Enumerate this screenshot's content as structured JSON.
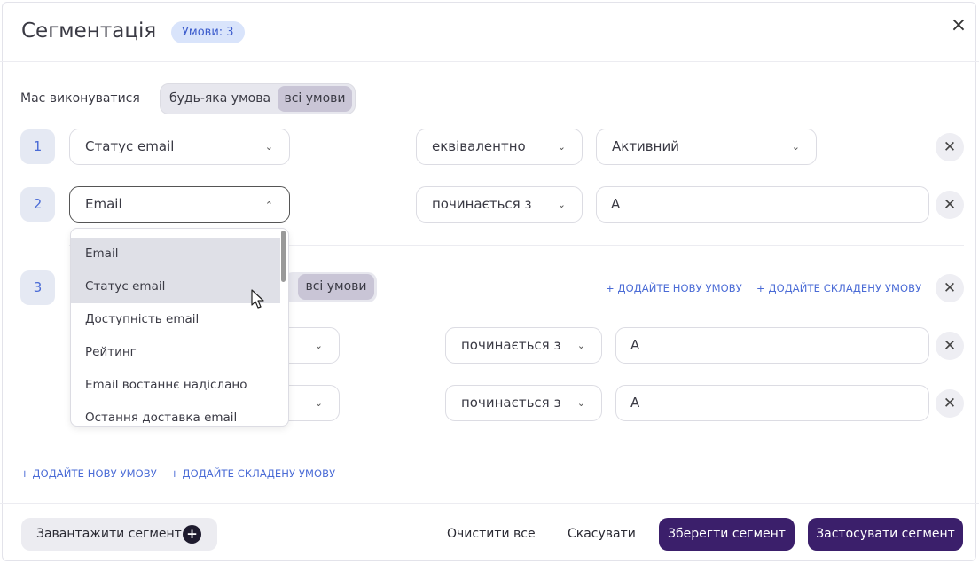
{
  "header": {
    "title": "Сегментація",
    "badge": "Умови: 3",
    "close_icon": "×"
  },
  "match": {
    "label": "Має виконуватися",
    "options": [
      "будь-яка умова",
      "всі умови"
    ],
    "selected": "всі умови"
  },
  "rows": [
    {
      "num": "1",
      "field": "Статус email",
      "operator": "еквівалентно",
      "value": "Активний"
    },
    {
      "num": "2",
      "field": "Email",
      "operator": "починається з",
      "value": "A"
    }
  ],
  "group": {
    "num": "3",
    "toggle_active": "всі умови",
    "add_condition": "+ ДОДАЙТЕ НОВУ УМОВУ",
    "add_complex": "+ ДОДАЙТЕ СКЛАДЕНУ УМОВУ",
    "rows": [
      {
        "operator": "починається з",
        "value": "A"
      },
      {
        "operator": "починається з",
        "value": "A"
      }
    ]
  },
  "dropdown": {
    "items": [
      "Email",
      "Статус email",
      "Доступність email",
      "Рейтинг",
      "Email востаннє надіслано",
      "Остання доставка email"
    ],
    "highlighted": [
      "Email",
      "Статус email"
    ]
  },
  "links": {
    "add_condition": "+ ДОДАЙТЕ НОВУ УМОВУ",
    "add_complex": "+ ДОДАЙТЕ СКЛАДЕНУ УМОВУ"
  },
  "footer": {
    "load": "Завантажити сегмент",
    "clear": "Очистити все",
    "cancel": "Скасувати",
    "save": "Зберегти сегмент",
    "apply": "Застосувати сегмент"
  },
  "colors": {
    "primary": "#3b1f6b",
    "accent": "#4a6bd6",
    "badge_bg": "#d9e4fb"
  }
}
